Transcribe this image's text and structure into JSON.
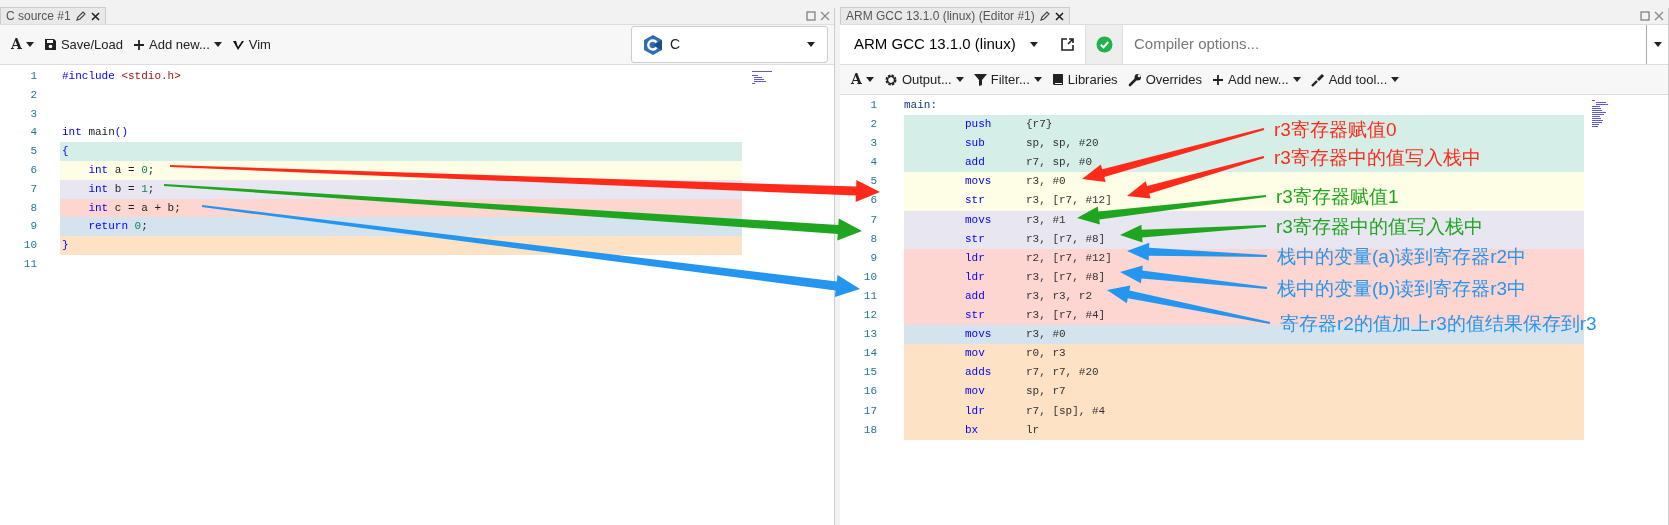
{
  "source_pane": {
    "tab": {
      "title": "C source #1"
    },
    "toolbar": [
      {
        "label": "A",
        "dropdown": true
      },
      {
        "label": "Save/Load",
        "dropdown": false
      },
      {
        "label": "Add new...",
        "dropdown": true
      },
      {
        "label": "Vim",
        "dropdown": false
      }
    ],
    "language": {
      "value": "C"
    },
    "lines": [
      {
        "number": "1",
        "indented": false,
        "tokens": [
          {
            "t": "#include",
            "kind": "keyword"
          },
          {
            "t": " <stdio.h>",
            "kind": "string"
          }
        ]
      },
      {
        "number": "2"
      },
      {
        "number": "3"
      },
      {
        "number": "4",
        "indented": false,
        "tokens": [
          {
            "t": "int",
            "kind": "keyword"
          },
          {
            "t": " main",
            "kind": "plain"
          },
          {
            "t": "()",
            "kind": "keyword"
          }
        ]
      },
      {
        "number": "5",
        "indented": false,
        "color": "#d5eee8",
        "tokens": [
          {
            "t": "{",
            "kind": "keyword"
          }
        ]
      },
      {
        "number": "6",
        "indented": true,
        "color": "#fefde5",
        "tokens": [
          {
            "t": "int",
            "kind": "keyword"
          },
          {
            "t": " a = ",
            "kind": "plain"
          },
          {
            "t": "0",
            "kind": "number"
          },
          {
            "t": ";",
            "kind": "plain"
          }
        ]
      },
      {
        "number": "7",
        "indented": true,
        "color": "#e7e6f1",
        "tokens": [
          {
            "t": "int",
            "kind": "keyword"
          },
          {
            "t": " b = ",
            "kind": "plain"
          },
          {
            "t": "1",
            "kind": "number"
          },
          {
            "t": ";",
            "kind": "plain"
          }
        ]
      },
      {
        "number": "8",
        "indented": true,
        "color": "#fdd6d2",
        "tokens": [
          {
            "t": "int",
            "kind": "keyword"
          },
          {
            "t": " c = a + b;",
            "kind": "plain"
          }
        ]
      },
      {
        "number": "9",
        "indented": true,
        "color": "#d4e3ee",
        "tokens": [
          {
            "t": "return",
            "kind": "keyword"
          },
          {
            "t": " 0",
            "kind": "number"
          },
          {
            "t": ";",
            "kind": "plain"
          }
        ]
      },
      {
        "number": "10",
        "indented": false,
        "color": "#fde2c5",
        "tokens": [
          {
            "t": "}",
            "kind": "keyword"
          }
        ]
      },
      {
        "number": "11"
      }
    ]
  },
  "compiler_pane": {
    "tab": {
      "title": "ARM GCC 13.1.0 (linux) (Editor #1)"
    },
    "compiler": {
      "value": "ARM GCC 13.1.0 (linux)"
    },
    "compile_ok": true,
    "options": {
      "placeholder": "Compiler options..."
    },
    "toolbar": [
      {
        "label": "A",
        "dropdown": true
      },
      {
        "label": "Output...",
        "dropdown": true
      },
      {
        "label": "Filter...",
        "dropdown": true
      },
      {
        "label": "Libraries",
        "dropdown": false
      },
      {
        "label": "Overrides",
        "dropdown": false
      },
      {
        "label": "Add new...",
        "dropdown": true
      },
      {
        "label": "Add tool...",
        "dropdown": true
      }
    ],
    "lines": [
      {
        "number": "1",
        "kind": "label",
        "text": "main:"
      },
      {
        "number": "2",
        "kind": "instruction",
        "op": "push",
        "args": "{r7}",
        "color": "#d5eee8"
      },
      {
        "number": "3",
        "kind": "instruction",
        "op": "sub",
        "args": "sp, sp, #20",
        "color": "#d5eee8"
      },
      {
        "number": "4",
        "kind": "instruction",
        "op": "add",
        "args": "r7, sp, #0",
        "color": "#d5eee8"
      },
      {
        "number": "5",
        "kind": "instruction",
        "op": "movs",
        "args": "r3, #0",
        "color": "#fefde5"
      },
      {
        "number": "6",
        "kind": "instruction",
        "op": "str",
        "args": "r3, [r7, #12]",
        "color": "#fefde5"
      },
      {
        "number": "7",
        "kind": "instruction",
        "op": "movs",
        "args": "r3, #1",
        "color": "#e7e6f1"
      },
      {
        "number": "8",
        "kind": "instruction",
        "op": "str",
        "args": "r3, [r7, #8]",
        "color": "#e7e6f1"
      },
      {
        "number": "9",
        "kind": "instruction",
        "op": "ldr",
        "args": "r2, [r7, #12]",
        "color": "#fdd6d2"
      },
      {
        "number": "10",
        "kind": "instruction",
        "op": "ldr",
        "args": "r3, [r7, #8]",
        "color": "#fdd6d2"
      },
      {
        "number": "11",
        "kind": "instruction",
        "op": "add",
        "args": "r3, r3, r2",
        "color": "#fdd6d2"
      },
      {
        "number": "12",
        "kind": "instruction",
        "op": "str",
        "args": "r3, [r7, #4]",
        "color": "#fdd6d2"
      },
      {
        "number": "13",
        "kind": "instruction",
        "op": "movs",
        "args": "r3, #0",
        "color": "#d4e3ee"
      },
      {
        "number": "14",
        "kind": "instruction",
        "op": "mov",
        "args": "r0, r3",
        "color": "#fde2c5"
      },
      {
        "number": "15",
        "kind": "instruction",
        "op": "adds",
        "args": "r7, r7, #20",
        "color": "#fde2c5"
      },
      {
        "number": "16",
        "kind": "instruction",
        "op": "mov",
        "args": "sp, r7",
        "color": "#fde2c5"
      },
      {
        "number": "17",
        "kind": "instruction",
        "op": "ldr",
        "args": "r7, [sp], #4",
        "color": "#fde2c5"
      },
      {
        "number": "18",
        "kind": "instruction",
        "op": "bx",
        "args": "lr",
        "color": "#fde2c5"
      }
    ]
  },
  "links": [
    {
      "color": "#ff2a1a"
    },
    {
      "color": "#1fa51f"
    },
    {
      "color": "#2496ef"
    }
  ],
  "annotations": [
    {
      "text": "r3寄存器赋值0",
      "color": "#ff2a1a"
    },
    {
      "text": "r3寄存器中的值写入栈中",
      "color": "#ff2a1a"
    },
    {
      "text": "r3寄存器赋值1",
      "color": "#1fa51f"
    },
    {
      "text": "r3寄存器中的值写入栈中",
      "color": "#1fa51f"
    },
    {
      "text": "栈中的变量(a)读到寄存器r2中",
      "color": "#2496ef"
    },
    {
      "text": "栈中的变量(b)读到寄存器r3中",
      "color": "#2496ef"
    },
    {
      "text": "寄存器r2的值加上r3的值结果保存到r3",
      "color": "#2496ef"
    }
  ]
}
